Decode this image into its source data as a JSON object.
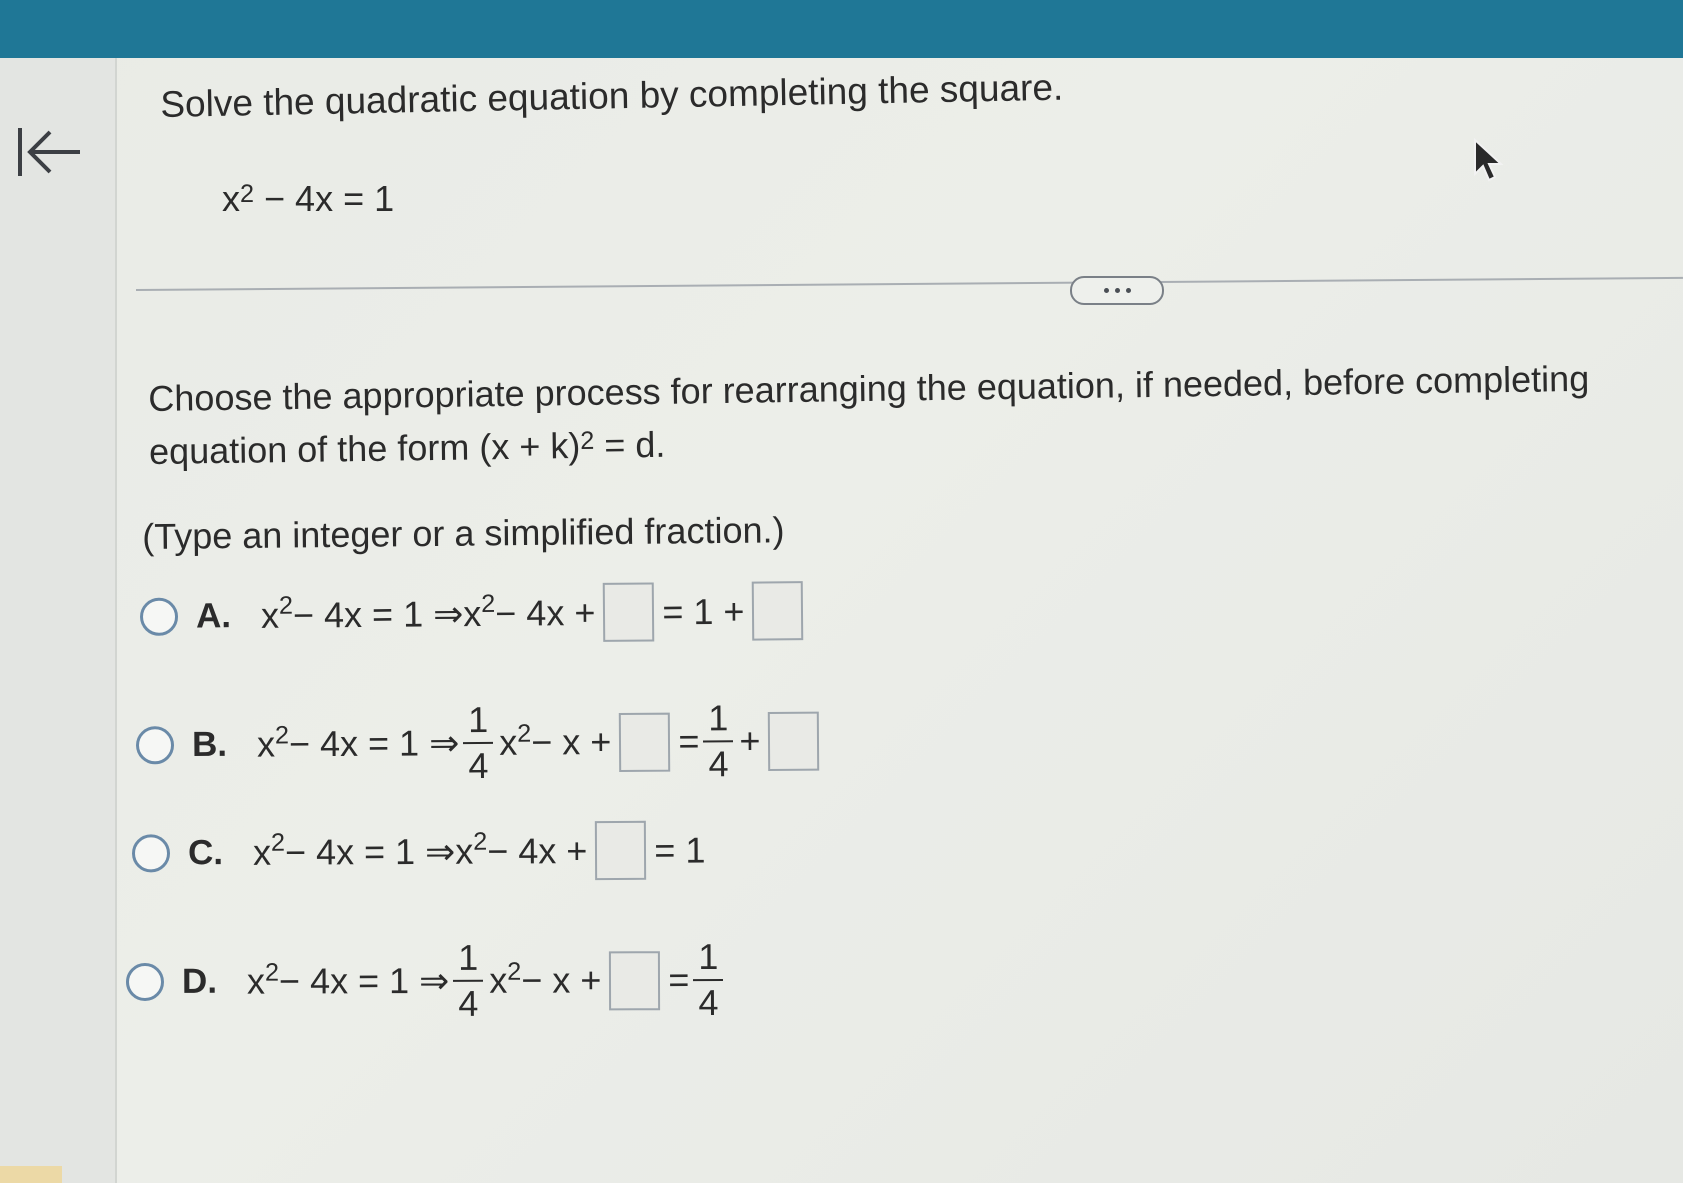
{
  "nav": {
    "back_icon": "first-page-arrow-icon"
  },
  "question": {
    "title": "Solve the quadratic equation by completing the square.",
    "equation": {
      "base": "x",
      "exp": "2",
      "rest": " − 4x = 1"
    }
  },
  "more_button": {
    "icon": "ellipsis-icon"
  },
  "instruction": {
    "line1": "Choose the appropriate process for rearranging the equation, if needed, before completing",
    "line2_prefix": "equation of the form (x + k)",
    "line2_exp": "2",
    "line2_suffix": " = d."
  },
  "hint": "(Type an integer or a simplified fraction.)",
  "options": [
    {
      "letter": "A.",
      "lhs_base": "x",
      "lhs_exp": "2",
      "lhs_rest": " − 4x = 1 ⇒ ",
      "r_base": "x",
      "r_exp": "2",
      "r_rest": " − 4x + ",
      "eq_mid": " = 1 + "
    },
    {
      "letter": "B.",
      "lhs_base": "x",
      "lhs_exp": "2",
      "lhs_rest": " − 4x = 1 ⇒ ",
      "frac_num": "1",
      "frac_den": "4",
      "r_base": "x",
      "r_exp": "2",
      "r_rest": " − x + ",
      "eq": " = ",
      "frac2_num": "1",
      "frac2_den": "4",
      "plus": " + "
    },
    {
      "letter": "C.",
      "lhs_base": "x",
      "lhs_exp": "2",
      "lhs_rest": " − 4x = 1 ⇒ ",
      "r_base": "x",
      "r_exp": "2",
      "r_rest": " − 4x + ",
      "tail": " = 1"
    },
    {
      "letter": "D.",
      "lhs_base": "x",
      "lhs_exp": "2",
      "lhs_rest": " − 4x = 1 ⇒ ",
      "frac_num": "1",
      "frac_den": "4",
      "r_base": "x",
      "r_exp": "2",
      "r_rest": " − x + ",
      "eq": " = ",
      "frac2_num": "1",
      "frac2_den": "4"
    }
  ],
  "colors": {
    "topbar": "#1f7796",
    "radio_border": "#6a8aa8",
    "answer_box_border": "#9ea6ad"
  }
}
